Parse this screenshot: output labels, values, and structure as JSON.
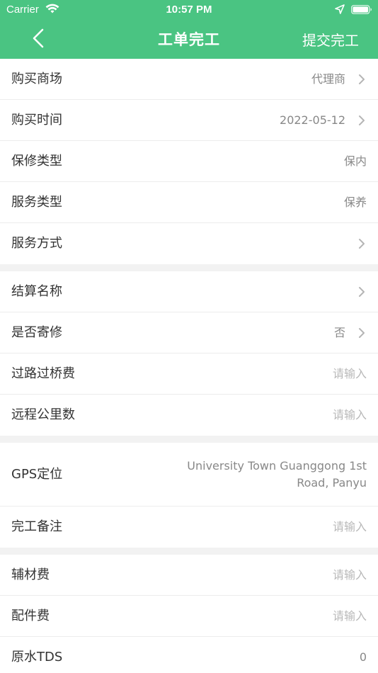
{
  "status_bar": {
    "carrier": "Carrier",
    "time": "10:57 PM"
  },
  "nav": {
    "title": "工单完工",
    "submit_label": "提交完工"
  },
  "colors": {
    "header_bg": "#4ac482",
    "label_text": "#333333",
    "value_text": "#888888",
    "placeholder_text": "#b8b8b8"
  },
  "form": {
    "store": {
      "label": "购买商场",
      "value": "代理商"
    },
    "purchase_time": {
      "label": "购买时间",
      "value": "2022-05-12"
    },
    "warranty_type": {
      "label": "保修类型",
      "value": "保内"
    },
    "service_type": {
      "label": "服务类型",
      "value": "保养"
    },
    "service_method": {
      "label": "服务方式",
      "value": ""
    },
    "settlement_name": {
      "label": "结算名称",
      "value": ""
    },
    "mail_repair": {
      "label": "是否寄修",
      "value": "否"
    },
    "toll_fee": {
      "label": "过路过桥费",
      "placeholder": "请输入"
    },
    "remote_km": {
      "label": "远程公里数",
      "placeholder": "请输入"
    },
    "gps": {
      "label": "GPS定位",
      "value_line1": "University Town Guanggong 1st",
      "value_line2": "Road, Panyu"
    },
    "remark": {
      "label": "完工备注",
      "placeholder": "请输入"
    },
    "material_fee": {
      "label": "辅材费",
      "placeholder": "请输入"
    },
    "parts_fee": {
      "label": "配件费",
      "placeholder": "请输入"
    },
    "raw_tds": {
      "label": "原水TDS",
      "value": "0"
    }
  },
  "icons": {
    "wifi": "wifi-icon",
    "location": "location-arrow-icon",
    "battery": "battery-icon",
    "back": "chevron-left-icon",
    "chevron": "chevron-right-icon"
  }
}
